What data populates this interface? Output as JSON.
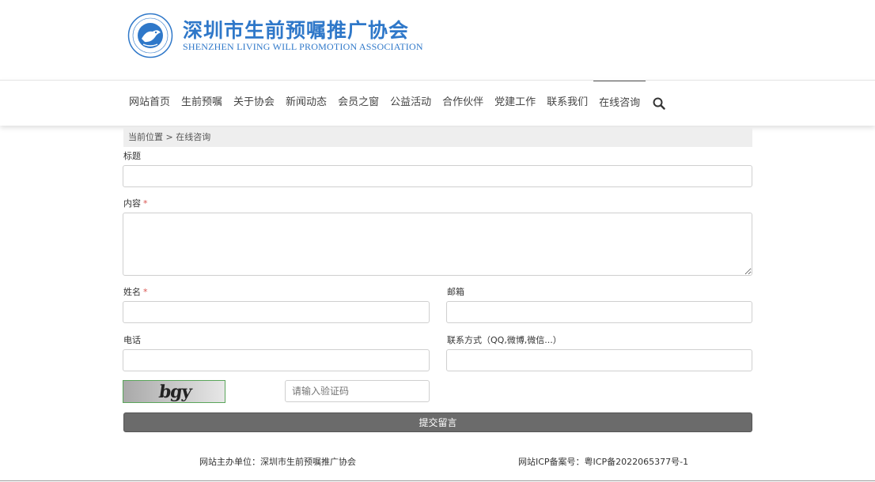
{
  "header": {
    "brand_cn": "深圳市生前预嘱推广协会",
    "brand_en": "SHENZHEN LIVING WILL PROMOTION ASSOCIATION",
    "brand_color": "#2f78c9"
  },
  "nav": {
    "items": [
      {
        "label": "网站首页"
      },
      {
        "label": "生前预嘱"
      },
      {
        "label": "关于协会"
      },
      {
        "label": "新闻动态"
      },
      {
        "label": "会员之窗"
      },
      {
        "label": "公益活动"
      },
      {
        "label": "合作伙伴"
      },
      {
        "label": "党建工作"
      },
      {
        "label": "联系我们"
      },
      {
        "label": "在线咨询",
        "active": true
      }
    ],
    "search_icon": "search-icon"
  },
  "breadcrumb": "当前位置 > 在线咨询",
  "form": {
    "title_label": "标题",
    "title_value": "",
    "content_label": "内容",
    "content_value": "",
    "required_mark": "*",
    "name_label": "姓名",
    "name_value": "",
    "email_label": "邮箱",
    "email_value": "",
    "phone_label": "电话",
    "phone_value": "",
    "contact_label": "联系方式（QQ,微博,微信...）",
    "contact_value": "",
    "captcha_text": "bgy",
    "captcha_placeholder": "请输入验证码",
    "submit_label": "提交留言"
  },
  "footer": {
    "sponsor": "网站主办单位：深圳市生前预嘱推广协会",
    "icp": "网站ICP备案号：粤ICP备2022065377号-1"
  }
}
